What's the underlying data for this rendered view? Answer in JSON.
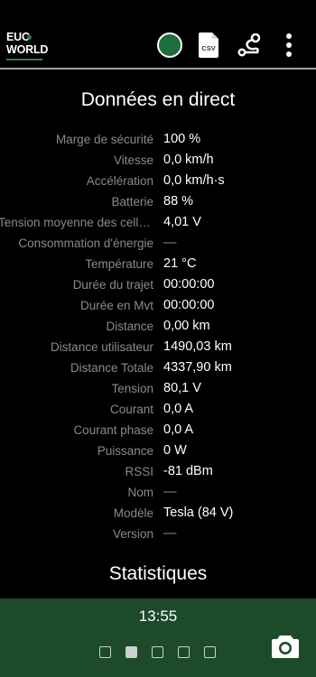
{
  "header": {
    "logo_line1": "EUC",
    "logo_line2": "WORLD",
    "csv_label": "CSV",
    "status_color": "#1e6e3c",
    "icons": [
      "status-dot-icon",
      "csv-file-icon",
      "route-icon",
      "more-vert-icon"
    ]
  },
  "live": {
    "title": "Données en direct",
    "rows": [
      {
        "label": "Marge de sécurité",
        "value": "100 %"
      },
      {
        "label": "Vitesse",
        "value": "0,0 km/h"
      },
      {
        "label": "Accélération",
        "value": "0,0 km/h·s"
      },
      {
        "label": "Batterie",
        "value": "88 %"
      },
      {
        "label": "Tension moyenne des cellules",
        "value": "4,01 V"
      },
      {
        "label": "Consommation d'énergie",
        "value": "—"
      },
      {
        "label": "Température",
        "value": "21 °C"
      },
      {
        "label": "Durée du trajet",
        "value": "00:00:00"
      },
      {
        "label": "Durée en Mvt",
        "value": "00:00:00"
      },
      {
        "label": "Distance",
        "value": "0,00 km"
      },
      {
        "label": "Distance utilisateur",
        "value": "1490,03 km"
      },
      {
        "label": "Distance Totale",
        "value": "4337,90 km"
      },
      {
        "label": "Tension",
        "value": "80,1 V"
      },
      {
        "label": "Courant",
        "value": "0,0 A"
      },
      {
        "label": "Courant phase",
        "value": "0,0 A"
      },
      {
        "label": "Puissance",
        "value": "0 W"
      },
      {
        "label": "RSSI",
        "value": "-81 dBm"
      },
      {
        "label": "Nom",
        "value": "—"
      },
      {
        "label": "Modèle",
        "value": "Tesla (84 V)"
      },
      {
        "label": "Version",
        "value": "—"
      }
    ]
  },
  "stats": {
    "title": "Statistiques"
  },
  "bottom": {
    "clock": "13:55",
    "page_count": 5,
    "active_page": 2,
    "accent_color": "#1d4a2b"
  }
}
